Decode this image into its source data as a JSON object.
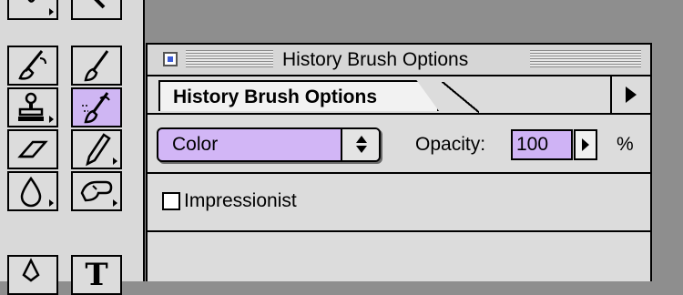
{
  "palette": {
    "title": "History Brush Options",
    "tab_label": "History Brush Options",
    "blend_mode": {
      "selected": "Color"
    },
    "opacity": {
      "label": "Opacity:",
      "value": "100",
      "unit": "%"
    },
    "impressionist": {
      "label": "Impressionist",
      "checked": false
    }
  },
  "toolbox": {
    "tools": [
      {
        "name": "lasso-tool"
      },
      {
        "name": "magic-wand-tool"
      },
      {
        "name": "airbrush-tool"
      },
      {
        "name": "paintbrush-tool"
      },
      {
        "name": "rubber-stamp-tool"
      },
      {
        "name": "history-brush-tool",
        "selected": true
      },
      {
        "name": "eraser-tool"
      },
      {
        "name": "pencil-tool"
      },
      {
        "name": "blur-tool"
      },
      {
        "name": "smudge-tool"
      },
      {
        "name": "pen-tool"
      },
      {
        "name": "type-tool",
        "letter": "T"
      }
    ]
  },
  "colors": {
    "selection": "#cfb6f3",
    "background": "#8e8e8e",
    "panel": "#dcdcdc"
  }
}
